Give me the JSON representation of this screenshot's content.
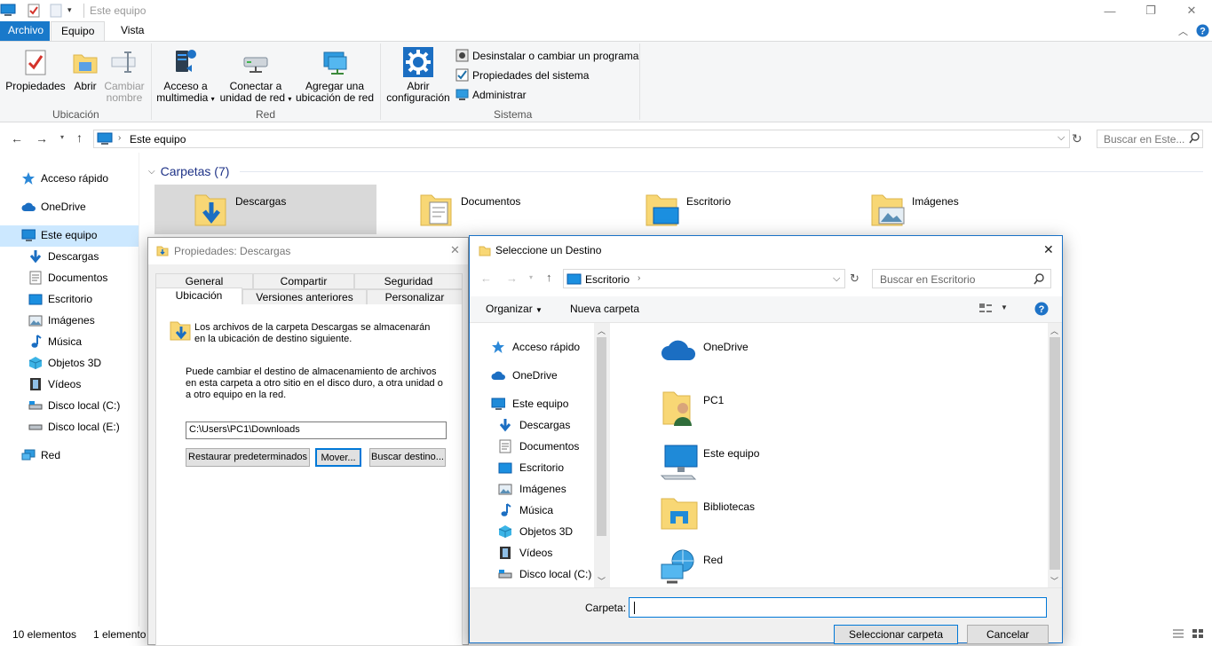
{
  "window": {
    "title": "Este equipo",
    "quick_access": [
      "properties-icon",
      "new-folder-icon",
      "dropdown-icon"
    ]
  },
  "ribbon_tabs": [
    {
      "label": "Archivo"
    },
    {
      "label": "Equipo"
    },
    {
      "label": "Vista"
    }
  ],
  "ribbon": {
    "ubicacion": {
      "group": "Ubicación",
      "propiedades": "Propiedades",
      "abrir": "Abrir",
      "cambiar1": "Cambiar",
      "cambiar2": "nombre"
    },
    "red": {
      "group": "Red",
      "acceso1": "Acceso a",
      "acceso2": "multimedia",
      "conectar1": "Conectar a",
      "conectar2": "unidad de red",
      "agregar1": "Agregar una",
      "agregar2": "ubicación de red"
    },
    "sistema": {
      "group": "Sistema",
      "abrir1": "Abrir",
      "abrir2": "configuración",
      "desinstalar": "Desinstalar o cambiar un programa",
      "propiedades_sistema": "Propiedades del sistema",
      "administrar": "Administrar"
    }
  },
  "address": {
    "path": "Este equipo",
    "search_placeholder": "Buscar en Este..."
  },
  "nav": [
    {
      "label": "Acceso rápido"
    },
    {
      "label": "OneDrive"
    },
    {
      "label": "Este equipo"
    },
    {
      "label": "Descargas"
    },
    {
      "label": "Documentos"
    },
    {
      "label": "Escritorio"
    },
    {
      "label": "Imágenes"
    },
    {
      "label": "Música"
    },
    {
      "label": "Objetos 3D"
    },
    {
      "label": "Vídeos"
    },
    {
      "label": "Disco local (C:)"
    },
    {
      "label": "Disco local (E:)"
    },
    {
      "label": "Red"
    }
  ],
  "main": {
    "section": "Carpetas (7)",
    "folders": [
      {
        "label": "Descargas"
      },
      {
        "label": "Documentos"
      },
      {
        "label": "Escritorio"
      },
      {
        "label": "Imágenes"
      }
    ]
  },
  "status": {
    "count": "10 elementos",
    "selected": "1 elemento"
  },
  "props_dialog": {
    "title": "Propiedades: Descargas",
    "tabs_row1": [
      "General",
      "Compartir",
      "Seguridad"
    ],
    "tabs_row2": [
      "Ubicación",
      "Versiones anteriores",
      "Personalizar"
    ],
    "info": "Los archivos de la carpeta Descargas se almacenarán en la ubicación de destino siguiente.",
    "desc": "Puede cambiar el destino de almacenamiento de archivos en esta carpeta a otro sitio en el disco duro, a otra unidad o a otro equipo en la red.",
    "path": "C:\\Users\\PC1\\Downloads",
    "btn_restore": "Restaurar predeterminados",
    "btn_move": "Mover...",
    "btn_find": "Buscar destino..."
  },
  "dest_dialog": {
    "title": "Seleccione un Destino",
    "path": "Escritorio",
    "search_placeholder": "Buscar en Escritorio",
    "organize": "Organizar",
    "new_folder": "Nueva carpeta",
    "nav": [
      {
        "label": "Acceso rápido"
      },
      {
        "label": "OneDrive"
      },
      {
        "label": "Este equipo"
      },
      {
        "label": "Descargas"
      },
      {
        "label": "Documentos"
      },
      {
        "label": "Escritorio"
      },
      {
        "label": "Imágenes"
      },
      {
        "label": "Música"
      },
      {
        "label": "Objetos 3D"
      },
      {
        "label": "Vídeos"
      },
      {
        "label": "Disco local (C:)"
      }
    ],
    "items": [
      {
        "label": "OneDrive"
      },
      {
        "label": "PC1"
      },
      {
        "label": "Este equipo"
      },
      {
        "label": "Bibliotecas"
      },
      {
        "label": "Red"
      }
    ],
    "folder_label": "Carpeta:",
    "folder_value": "",
    "btn_select": "Seleccionar carpeta",
    "btn_cancel": "Cancelar"
  },
  "colors": {
    "accent": "#1979ca",
    "selection": "#cce8ff",
    "folder": "#f8d775"
  }
}
